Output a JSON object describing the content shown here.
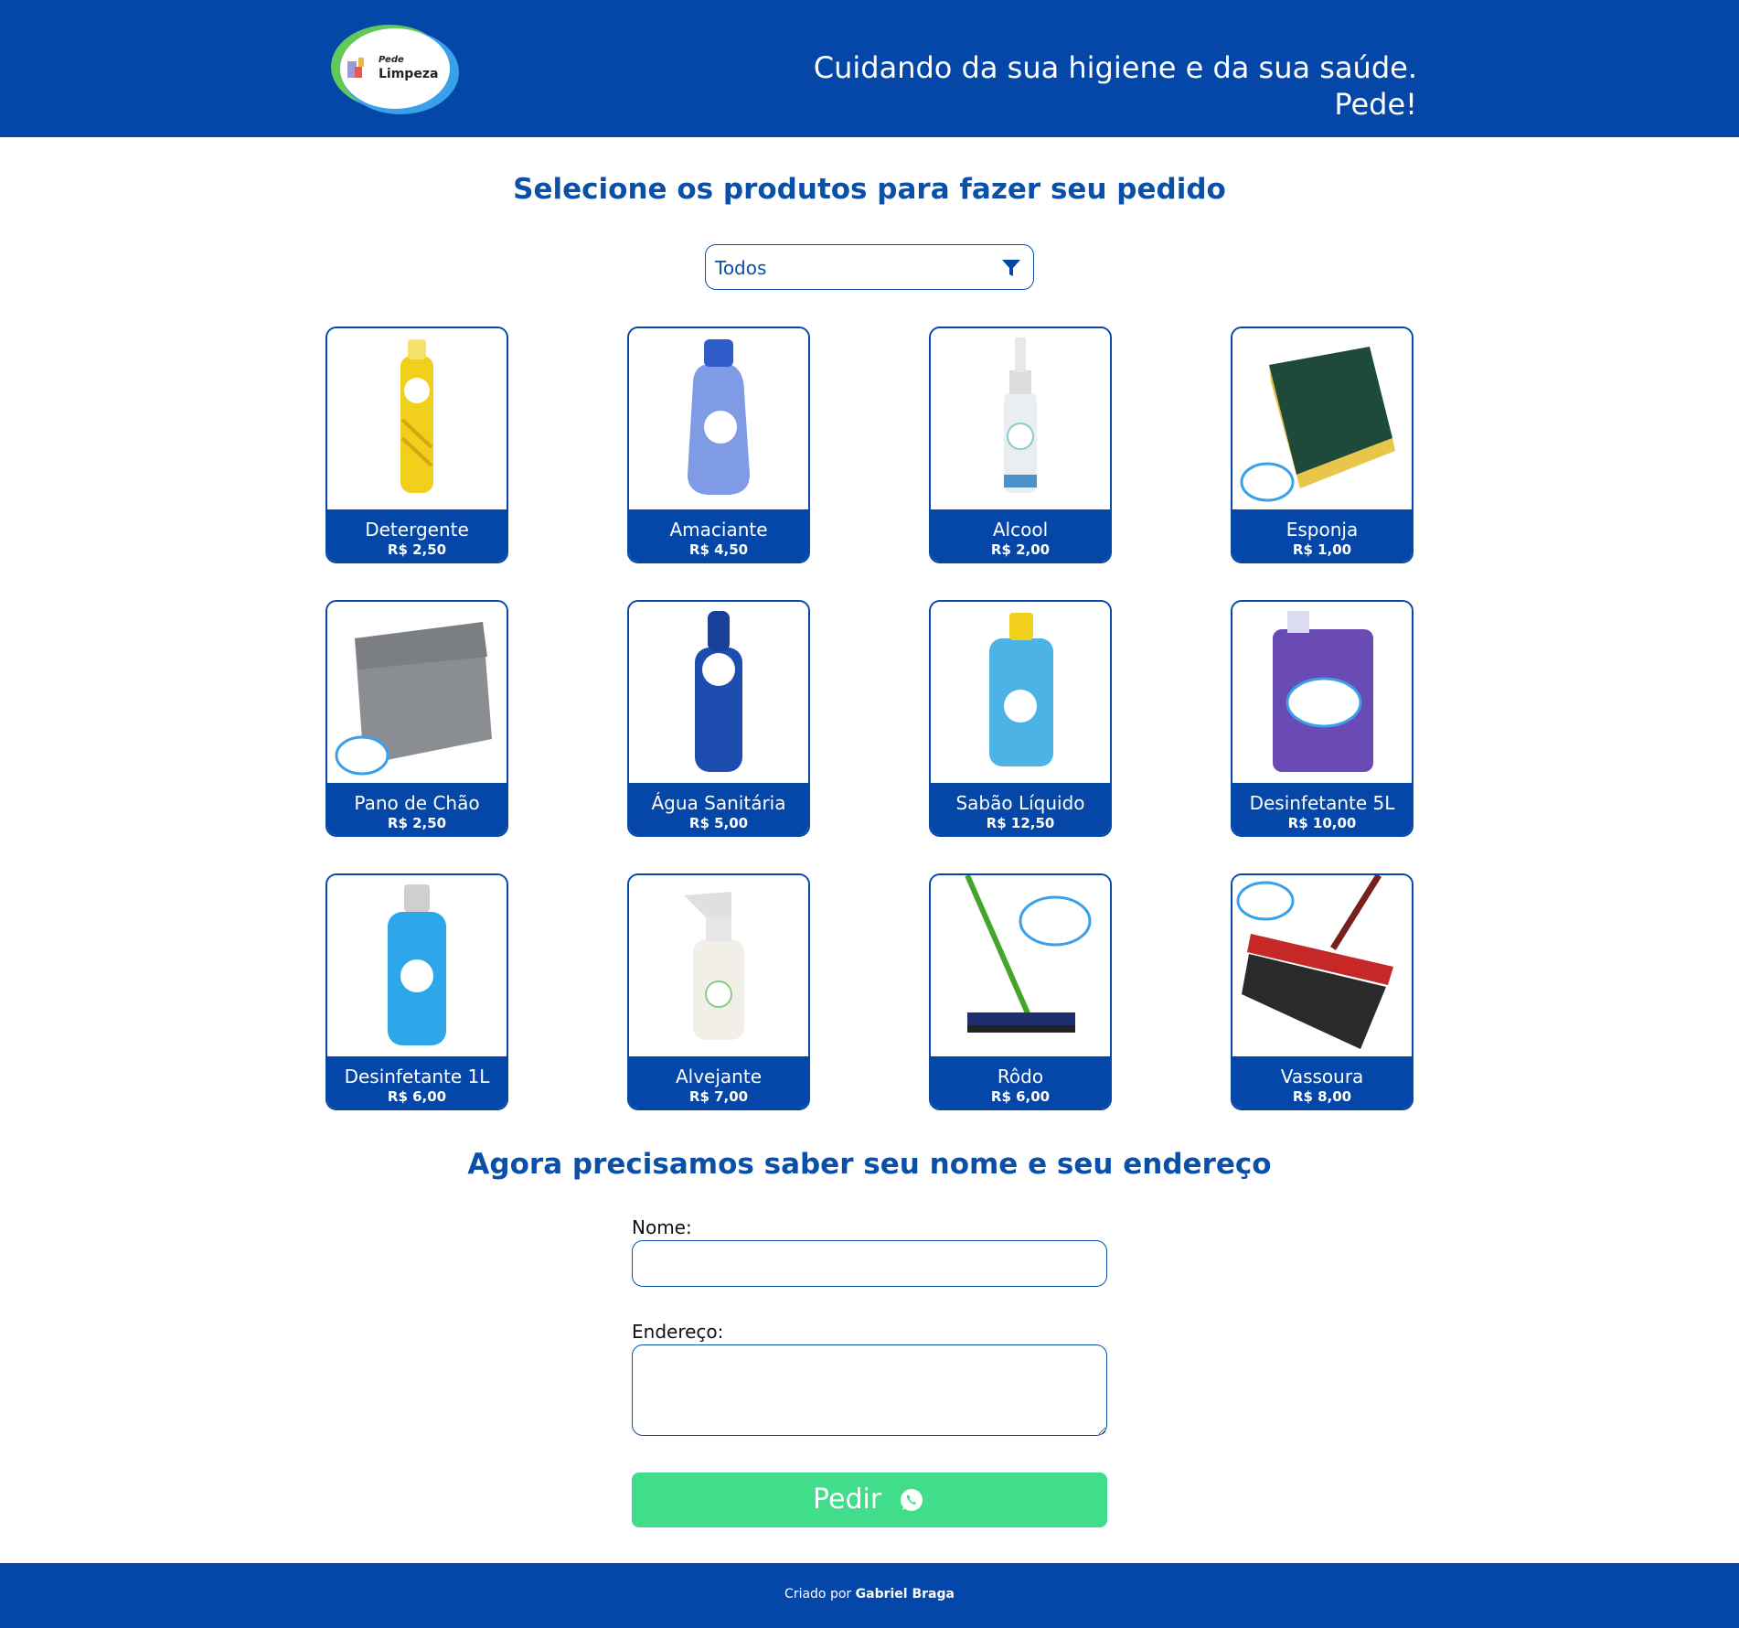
{
  "header": {
    "logo_small": "Pede",
    "logo_big": "Limpeza",
    "tagline": "Cuidando da sua higiene e da sua saúde. Pede!"
  },
  "products_section": {
    "title": "Selecione os produtos para fazer seu pedido",
    "filter_value": "Todos",
    "filter_icon": "filter-icon"
  },
  "products": [
    {
      "name": "Detergente",
      "price": "R$ 2,50",
      "image": "yellow-bottle"
    },
    {
      "name": "Amaciante",
      "price": "R$ 4,50",
      "image": "blue-softener-bottle"
    },
    {
      "name": "Alcool",
      "price": "R$ 2,00",
      "image": "spray-bottle"
    },
    {
      "name": "Esponja",
      "price": "R$ 1,00",
      "image": "sponge"
    },
    {
      "name": "Pano de Chão",
      "price": "R$ 2,50",
      "image": "floor-cloth"
    },
    {
      "name": "Água Sanitária",
      "price": "R$ 5,00",
      "image": "dark-blue-bottle"
    },
    {
      "name": "Sabão Líquido",
      "price": "R$ 12,50",
      "image": "light-blue-jug"
    },
    {
      "name": "Desinfetante 5L",
      "price": "R$ 10,00",
      "image": "purple-gallon"
    },
    {
      "name": "Desinfetante 1L",
      "price": "R$ 6,00",
      "image": "blue-bottle"
    },
    {
      "name": "Alvejante",
      "price": "R$ 7,00",
      "image": "trigger-spray"
    },
    {
      "name": "Rôdo",
      "price": "R$ 6,00",
      "image": "squeegee"
    },
    {
      "name": "Vassoura",
      "price": "R$ 8,00",
      "image": "broom"
    }
  ],
  "form": {
    "title": "Agora precisamos saber seu nome e seu endereço",
    "name_label": "Nome:",
    "name_value": "",
    "address_label": "Endereço:",
    "address_value": "",
    "submit_label": "Pedir",
    "submit_icon": "whatsapp-icon"
  },
  "footer": {
    "prefix": "Criado por",
    "author": "Gabriel Braga"
  },
  "colors": {
    "brand_blue": "#0447a9",
    "title_blue": "#0a4fa8",
    "button_green": "#40dd8a"
  }
}
